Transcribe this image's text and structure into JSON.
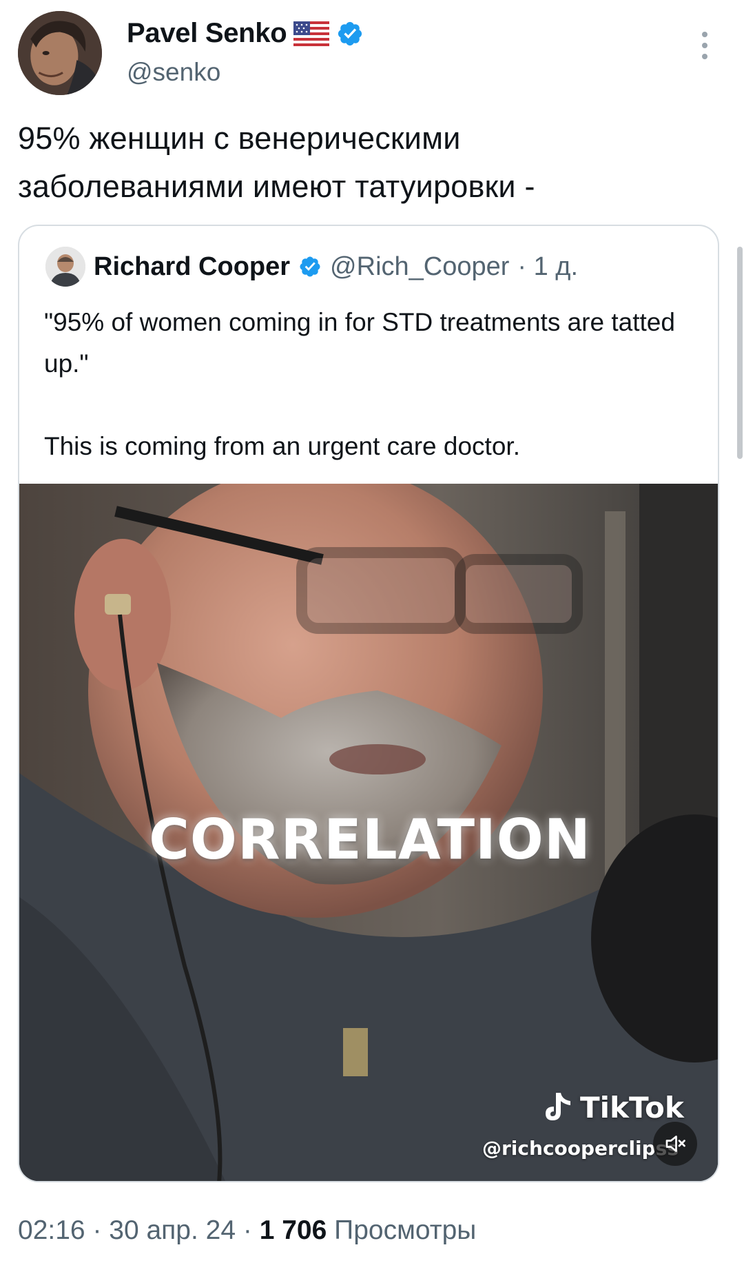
{
  "author": {
    "name": "Pavel Senko",
    "handle": "@senko",
    "flag_emoji": "🇺🇸",
    "verified": true
  },
  "tweet": {
    "text": "95% женщин с венерическими заболеваниями имеют татуировки -"
  },
  "quoted": {
    "name": "Richard Cooper",
    "handle": "@Rich_Cooper",
    "age": "· 1 д.",
    "verified": true,
    "text_line1": "\"95% of women coming in for STD treatments are tatted up.\"",
    "text_line2": "This is coming from an urgent care doctor.",
    "video": {
      "caption": "CORRELATION",
      "watermark": "TikTok",
      "watermark_user": "@richcooperclipss",
      "muted": true
    }
  },
  "meta": {
    "time": "02:16",
    "date": "30 апр. 24",
    "views_count": "1 706",
    "views_label": "Просмотры"
  },
  "colors": {
    "text": "#0f1419",
    "secondary": "#536471",
    "verified": "#1d9bf0",
    "border": "#d7dde2"
  },
  "icons": {
    "verified": "verified-badge-icon",
    "more": "more-options-icon",
    "mute": "speaker-muted-icon",
    "tiktok": "tiktok-logo-icon"
  }
}
